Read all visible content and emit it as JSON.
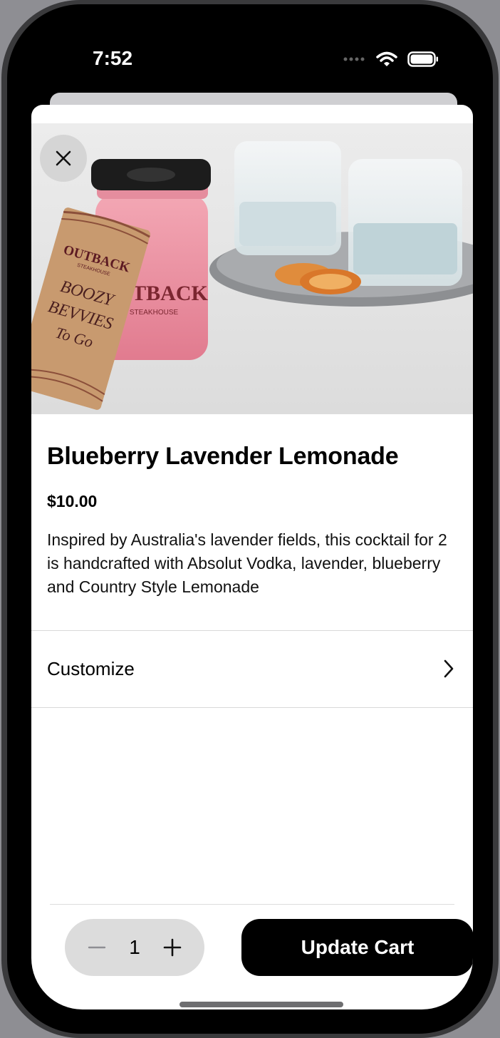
{
  "status_bar": {
    "time": "7:52",
    "icons": [
      "cellular-dots-icon",
      "wifi-icon",
      "battery-icon"
    ]
  },
  "product": {
    "image_icon_name": "drink-jar-photo",
    "image_text": {
      "jar_brand": "OUTBACK",
      "jar_sub": "STEAKHOUSE",
      "tag_brand": "OUTBACK",
      "tag_sub": "STEAKHOUSE",
      "tag_line1": "BOOZY",
      "tag_line2": "BEVVIES",
      "tag_line3": "To Go"
    },
    "title": "Blueberry Lavender Lemonade",
    "price": "$10.00",
    "description": "Inspired by Australia's lavender fields, this cocktail for 2 is handcrafted with Absolut Vodka, lavender, blueberry and Country Style Lemonade"
  },
  "customize": {
    "label": "Customize",
    "icon": "chevron-right-icon"
  },
  "footer": {
    "quantity": "1",
    "decrement_icon": "minus-icon",
    "increment_icon": "plus-icon",
    "update_label": "Update Cart"
  },
  "colors": {
    "primary": "#000000",
    "stepper_bg": "#dcdcdc",
    "drink": "#e9879a"
  }
}
